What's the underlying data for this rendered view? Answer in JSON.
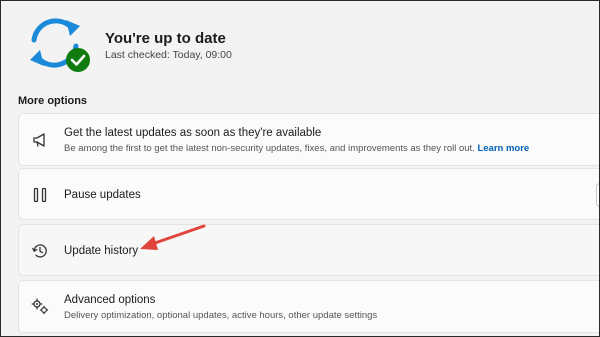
{
  "status": {
    "title": "You're up to date",
    "last_checked": "Last checked: Today, 09:00",
    "icon": "sync-check-icon",
    "icon_colors": {
      "arrows": "#1a8ad9",
      "check_badge": "#107c10"
    }
  },
  "section": {
    "title": "More options"
  },
  "options": [
    {
      "title": "Get the latest updates as soon as they're available",
      "description": "Be among the first to get the latest non-security updates, fixes, and improvements as they roll out.",
      "link": "Learn more",
      "icon": "megaphone-icon"
    },
    {
      "title": "Pause updates",
      "icon": "pause-icon"
    },
    {
      "title": "Update history",
      "icon": "history-icon"
    },
    {
      "title": "Advanced options",
      "description": "Delivery optimization, optional updates, active hours, other update settings",
      "icon": "gears-icon"
    }
  ],
  "annotation": {
    "icon": "red-arrow-icon",
    "color": "#e0443a"
  },
  "accent_color": "#005fb8"
}
